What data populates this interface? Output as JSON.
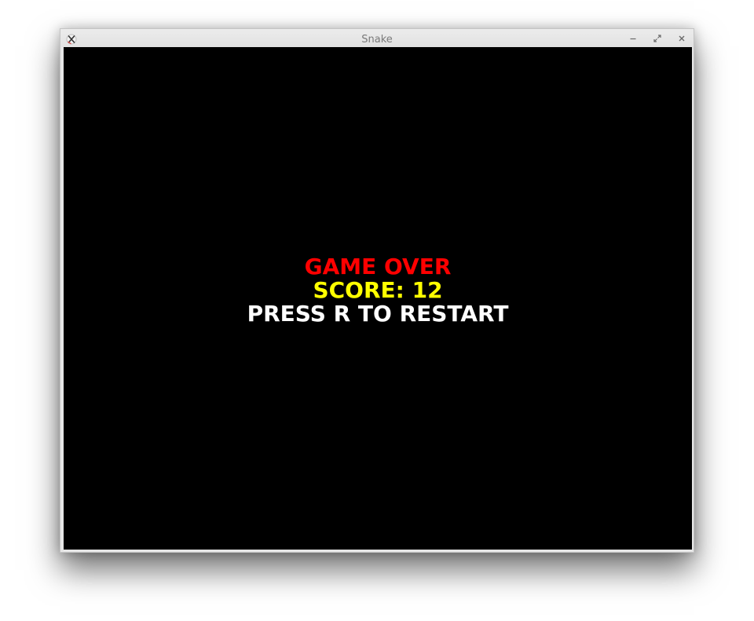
{
  "window": {
    "title": "Snake",
    "controls": {
      "minimize_icon": "minimize-icon",
      "maximize_icon": "maximize-icon",
      "close_icon": "close-icon"
    }
  },
  "game": {
    "background_color": "#000000",
    "game_over_text": "GAME OVER",
    "game_over_color": "#ff0000",
    "score_text": "SCORE: 12",
    "score_value": 12,
    "score_color": "#ffff00",
    "restart_text": "PRESS R TO RESTART",
    "restart_color": "#ffffff"
  }
}
